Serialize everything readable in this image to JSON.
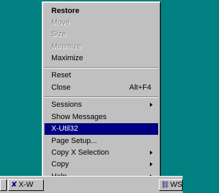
{
  "taskbar": {
    "xw_label": "X-W",
    "ws_label": "WS"
  },
  "menu": {
    "items": [
      {
        "label": "Restore"
      },
      {
        "label": "Move"
      },
      {
        "label": "Size"
      },
      {
        "label": "Minimize"
      },
      {
        "label": "Maximize"
      },
      {
        "label": "Reset"
      },
      {
        "label": "Close",
        "shortcut": "Alt+F4"
      },
      {
        "label": "Sessions"
      },
      {
        "label": "Show Messages"
      },
      {
        "label": "X-Util32"
      },
      {
        "label": "Page Setup..."
      },
      {
        "label": "Copy X Selection"
      },
      {
        "label": "Copy"
      },
      {
        "label": "Help"
      }
    ]
  },
  "colors": {
    "desktop": "#008080",
    "menu_bg": "#c0c0c0",
    "highlight": "#000080",
    "disabled_text": "#808080"
  }
}
